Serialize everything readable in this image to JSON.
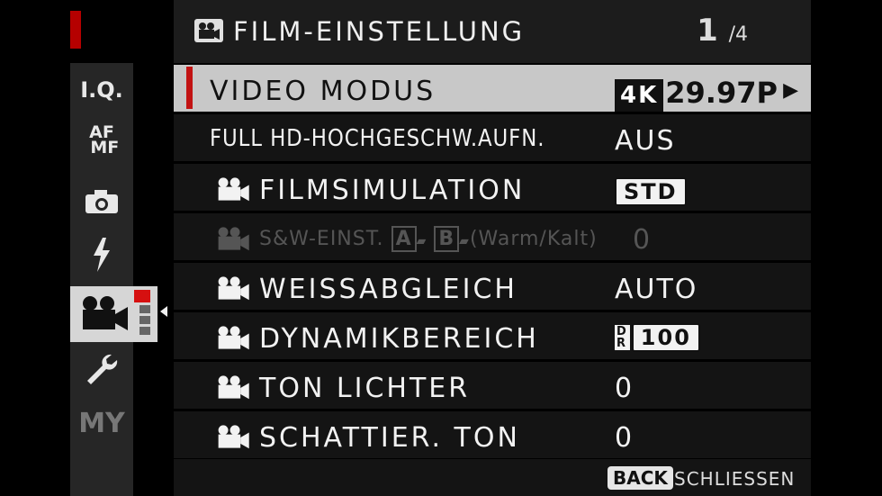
{
  "header": {
    "title": "FILM-EINSTELLUNG",
    "page_current": "1",
    "page_total": "/4"
  },
  "sidebar": {
    "items": [
      {
        "label": "I.Q.",
        "icon": "iq-icon"
      },
      {
        "label": "AF MF",
        "icon": "af-mf-icon"
      },
      {
        "label": "",
        "icon": "camera-icon"
      },
      {
        "label": "",
        "icon": "flash-icon"
      },
      {
        "label": "",
        "icon": "movie-camera-icon",
        "active": true
      },
      {
        "label": "",
        "icon": "wrench-icon"
      },
      {
        "label": "MY",
        "icon": "my-menu-icon"
      }
    ]
  },
  "menu": {
    "rows": [
      {
        "label": "VIDEO MODUS",
        "badge": "4K",
        "value": "29.97P",
        "selected": true
      },
      {
        "label": "FULL HD-HOCHGESCHW.AUFN.",
        "value": "AUS"
      },
      {
        "label": "FILMSIMULATION",
        "badge": "STD"
      },
      {
        "label": "S&W-EINST.",
        "label_suffix": "(Warm/Kalt)",
        "value": "0",
        "disabled": true
      },
      {
        "label": "WEISSABGLEICH",
        "value": "AUTO"
      },
      {
        "label": "DYNAMIKBEREICH",
        "badge_top": "D",
        "badge_bottom": "R",
        "value": "100"
      },
      {
        "label": "TON LICHTER",
        "value": "0"
      },
      {
        "label": "SCHATTIER. TON",
        "value": "0"
      }
    ]
  },
  "footer": {
    "back_key": "BACK",
    "back_label": "SCHLIESSEN"
  },
  "colors": {
    "accent": "#c21313",
    "selected_bg": "#c8c8c8",
    "row_bg": "#141414"
  }
}
